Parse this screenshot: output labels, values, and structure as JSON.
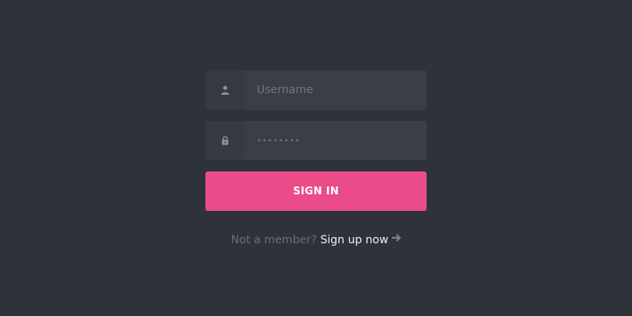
{
  "form": {
    "username": {
      "value": "",
      "placeholder": "Username",
      "icon": "user-icon"
    },
    "password": {
      "value": "••••••••",
      "icon": "lock-icon"
    },
    "submit_label": "SIGN IN"
  },
  "footer": {
    "prompt": "Not a member?",
    "link_label": "Sign up now",
    "arrow_icon": "arrow-right-icon"
  },
  "colors": {
    "background": "#2e3239",
    "field_bg": "#3a3f46",
    "icon_bg": "#363a41",
    "accent": "#ea4c89"
  }
}
